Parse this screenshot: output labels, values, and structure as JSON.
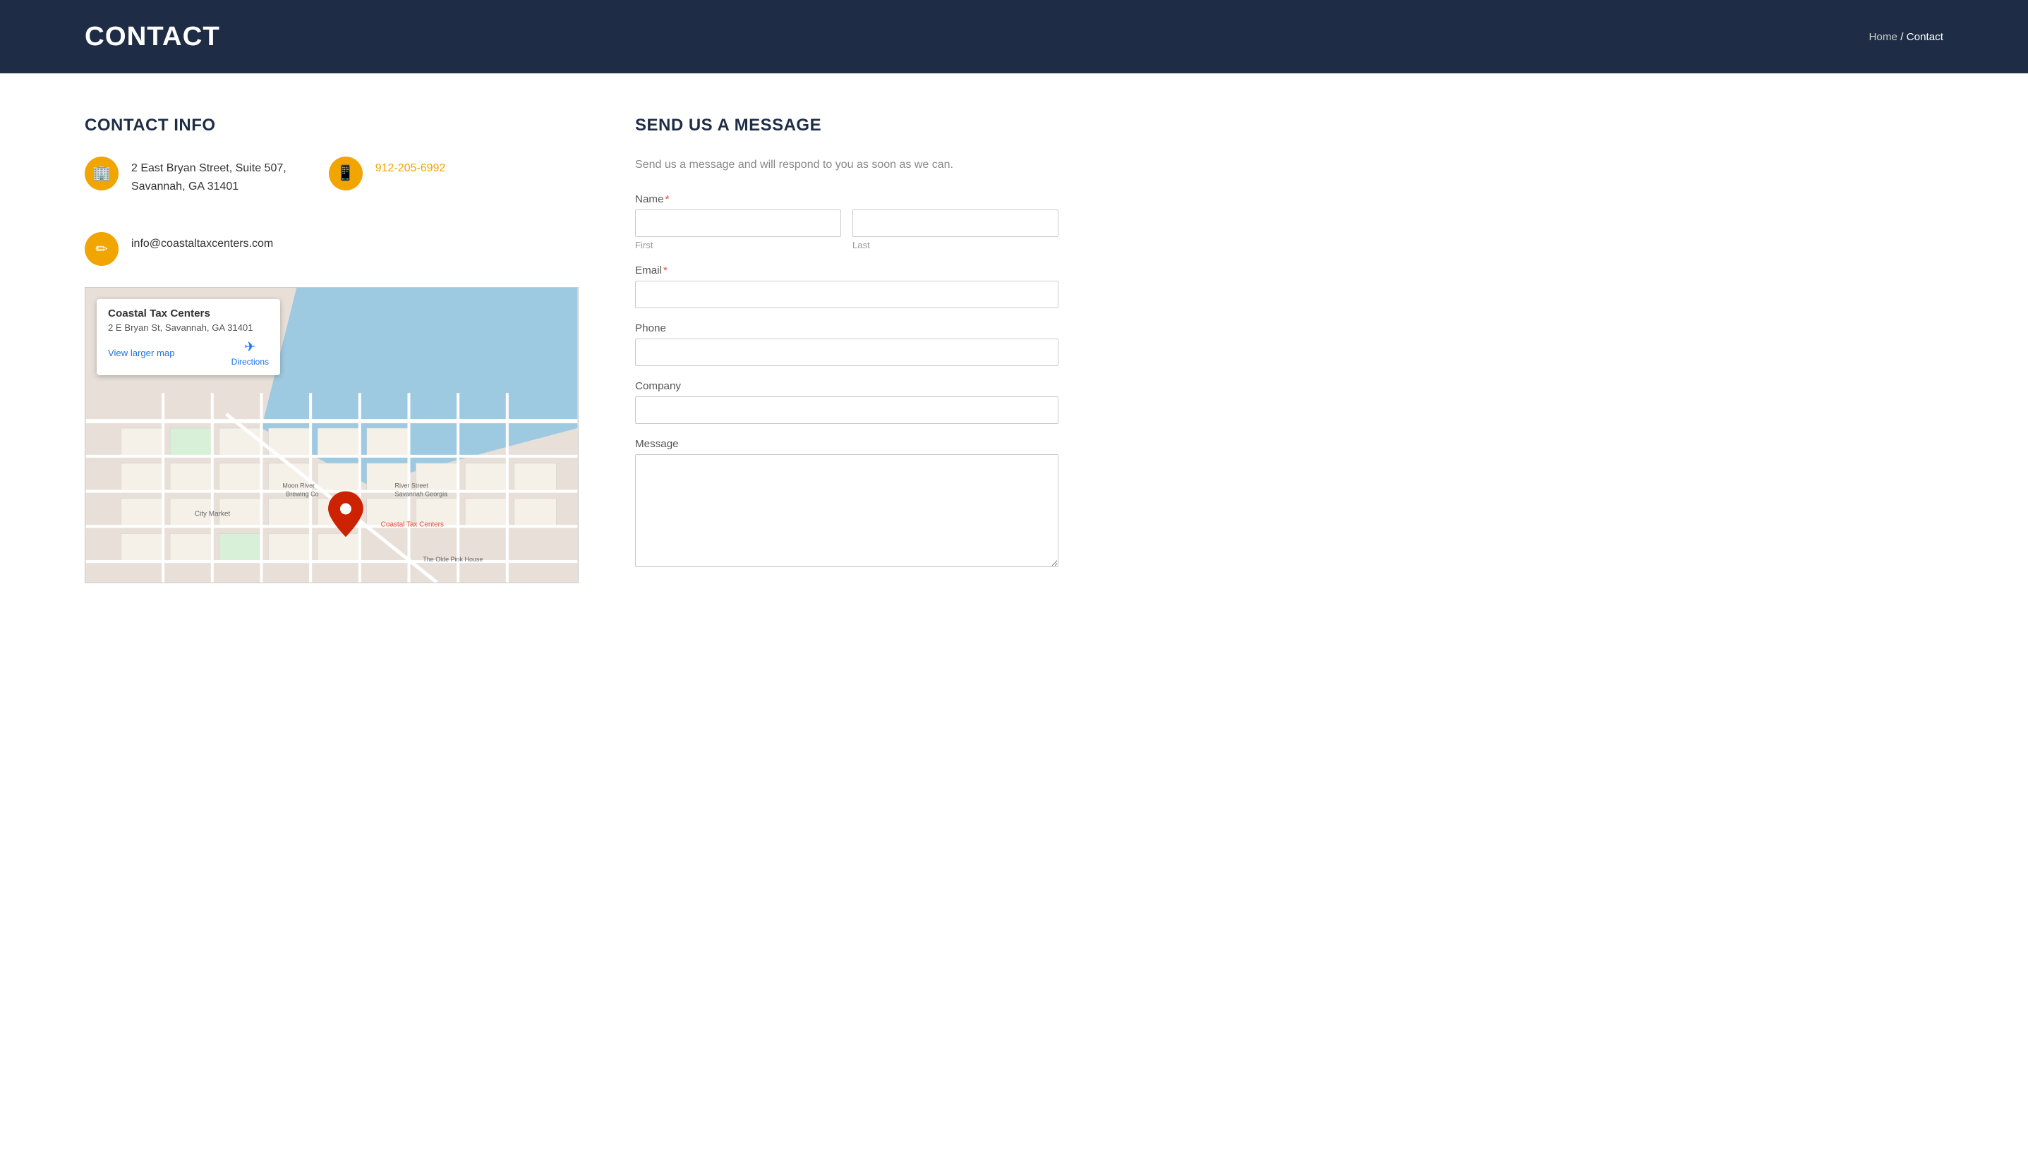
{
  "header": {
    "title": "CONTACT",
    "breadcrumb": {
      "home_label": "Home",
      "separator": "/",
      "current": "Contact"
    }
  },
  "left_section": {
    "title": "CONTACT INFO",
    "address": {
      "line1": "2 East Bryan Street, Suite 507,",
      "line2": "Savannah, GA 31401"
    },
    "phone": "912-205-6992",
    "email": "info@coastaltaxcenters.com",
    "map": {
      "business_name": "Coastal Tax Centers",
      "address": "2 E Bryan St, Savannah, GA 31401",
      "view_larger_label": "View larger map",
      "directions_label": "Directions"
    }
  },
  "right_section": {
    "title": "SEND US A MESSAGE",
    "subtitle": "Send us a message and will respond to you as soon as we can.",
    "form": {
      "name_label": "Name",
      "first_label": "First",
      "last_label": "Last",
      "email_label": "Email",
      "phone_label": "Phone",
      "company_label": "Company",
      "message_label": "Message"
    }
  }
}
